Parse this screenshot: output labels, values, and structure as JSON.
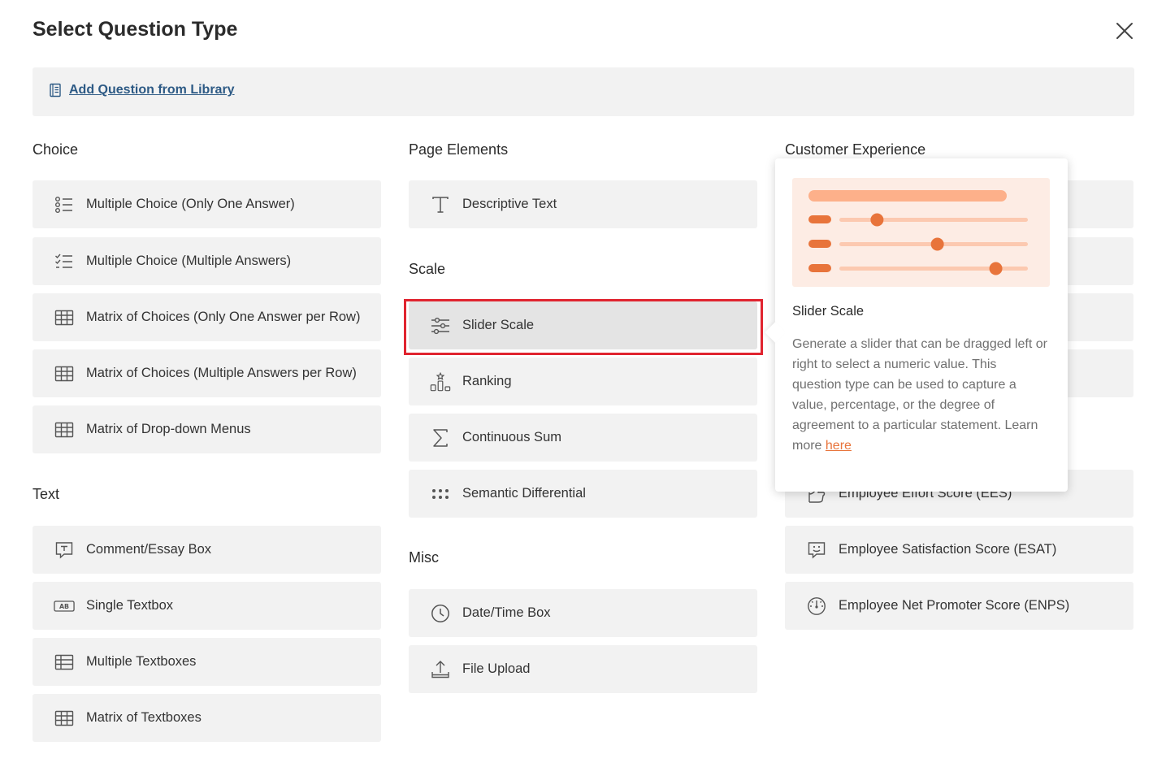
{
  "dialog": {
    "title": "Select Question Type",
    "close_icon": "close-icon"
  },
  "library": {
    "label": "Add Question from Library",
    "icon": "book-icon"
  },
  "sections": {
    "choice": {
      "title": "Choice",
      "items": [
        {
          "label": "Multiple Choice (Only One Answer)",
          "icon": "radio-list-icon"
        },
        {
          "label": "Multiple Choice (Multiple Answers)",
          "icon": "checklist-icon"
        },
        {
          "label": "Matrix of Choices (Only One Answer per Row)",
          "icon": "grid-icon"
        },
        {
          "label": "Matrix of Choices (Multiple Answers per Row)",
          "icon": "grid-icon"
        },
        {
          "label": "Matrix of Drop-down Menus",
          "icon": "grid-icon"
        }
      ]
    },
    "text": {
      "title": "Text",
      "items": [
        {
          "label": "Comment/Essay Box",
          "icon": "comment-icon"
        },
        {
          "label": "Single Textbox",
          "icon": "textbox-icon"
        },
        {
          "label": "Multiple Textboxes",
          "icon": "multi-textbox-icon"
        },
        {
          "label": "Matrix of Textboxes",
          "icon": "grid-icon"
        }
      ]
    },
    "page_elements": {
      "title": "Page Elements",
      "items": [
        {
          "label": "Descriptive Text",
          "icon": "text-t-icon"
        }
      ]
    },
    "scale": {
      "title": "Scale",
      "items": [
        {
          "label": "Slider Scale",
          "icon": "sliders-icon",
          "selected": true
        },
        {
          "label": "Ranking",
          "icon": "ranking-icon"
        },
        {
          "label": "Continuous Sum",
          "icon": "sigma-icon"
        },
        {
          "label": "Semantic Differential",
          "icon": "dots-grid-icon"
        }
      ]
    },
    "misc": {
      "title": "Misc",
      "items": [
        {
          "label": "Date/Time Box",
          "icon": "clock-icon"
        },
        {
          "label": "File Upload",
          "icon": "upload-icon"
        }
      ]
    },
    "customer_experience": {
      "title": "Customer Experience",
      "items": [
        {
          "label": "Employee Effort Score (EES)",
          "icon": "effort-icon"
        },
        {
          "label": "Employee Satisfaction Score (ESAT)",
          "icon": "smiley-chat-icon"
        },
        {
          "label": "Employee Net Promoter Score (ENPS)",
          "icon": "gauge-icon"
        }
      ]
    }
  },
  "tooltip": {
    "title": "Slider Scale",
    "description": "Generate a slider that can be dragged left or right to select a numeric value. This question type can be used to capture a value, percentage, or the degree of agreement to a particular statement.",
    "learn_more_prefix": "Learn more ",
    "learn_more_link": "here",
    "preview_icon": "slider-preview-illustration",
    "slider_levels": [
      0.2,
      0.52,
      0.83
    ]
  },
  "colors": {
    "accent_orange": "#e8743b",
    "highlight_red": "#e0242f",
    "item_bg": "#f2f2f2",
    "link_blue": "#2d5a85"
  }
}
